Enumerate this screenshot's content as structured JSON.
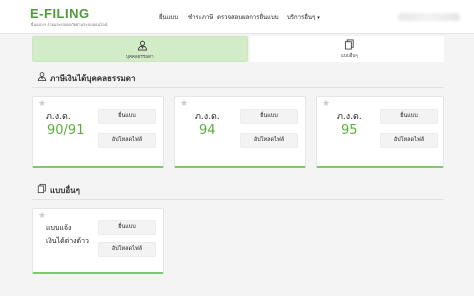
{
  "header": {
    "logo_title": "E-FILING",
    "logo_subtitle": "ยื่นแบบฯ ง่ายและปลอดภัยผ่านระบบออนไลน์",
    "nav": [
      {
        "label": "ยื่นแบบ"
      },
      {
        "label": "ชำระภาษี"
      },
      {
        "label": "ตรวจสอบผลการยื่นแบบ"
      },
      {
        "label": "บริการอื่นๆ",
        "caret": "▾"
      }
    ]
  },
  "tabs": [
    {
      "label": "บุคคลธรรมดา",
      "icon": "person-icon",
      "active": true
    },
    {
      "label": "แบบอื่นๆ",
      "icon": "documents-icon",
      "active": false
    }
  ],
  "sections": {
    "personal": {
      "title": "ภาษีเงินได้บุคคลธรรมดา",
      "icon": "person-icon"
    },
    "other": {
      "title": "แบบอื่นๆ",
      "icon": "documents-icon"
    }
  },
  "cards": [
    {
      "code": "ภ.ง.ด.",
      "number": "90/91",
      "submit_label": "ยื่นแบบ",
      "upload_label": "อัปโหลดไฟล์"
    },
    {
      "code": "ภ.ง.ด.",
      "number": "94",
      "submit_label": "ยื่นแบบ",
      "upload_label": "อัปโหลดไฟล์"
    },
    {
      "code": "ภ.ง.ด.",
      "number": "95",
      "submit_label": "ยื่นแบบ",
      "upload_label": "อัปโหลดไฟล์"
    }
  ],
  "other_cards": [
    {
      "line1": "แบบแจ้ง",
      "line2": "เงินได้ต่างด้าว",
      "submit_label": "ยื่นแบบ",
      "upload_label": "อัปโหลดไฟล์"
    }
  ],
  "colors": {
    "brand_green": "#4e9a3c",
    "accent_green": "#5aaf3c",
    "tab_active_bg": "#d3ecc8",
    "card_border_bottom": "#7ec96a"
  }
}
